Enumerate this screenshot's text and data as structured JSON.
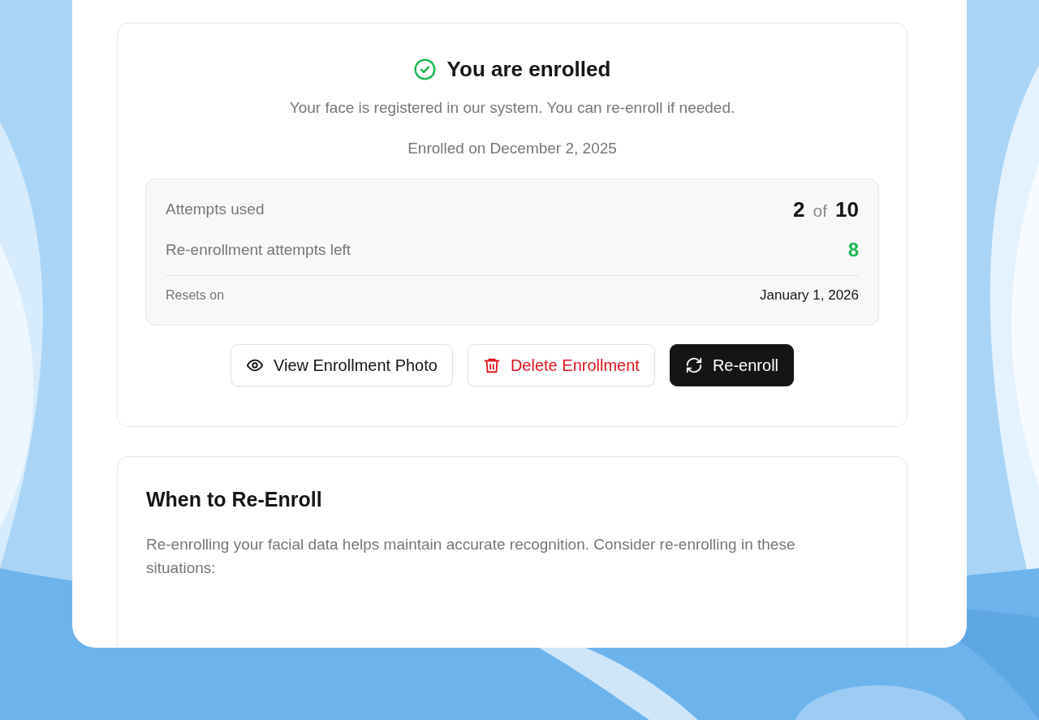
{
  "status_card": {
    "title": "You are enrolled",
    "enrolled": true,
    "description": "Your face is registered in our system. You can re-enroll if needed.",
    "enrolled_date": "Enrolled on December 2, 2025",
    "stats": [
      {
        "kind": "count",
        "label": "Attempts used",
        "value": "2",
        "separator": "of",
        "total": "10"
      },
      {
        "kind": "remaining",
        "label": "Re-enrollment attempts left",
        "value": "8"
      },
      {
        "kind": "date",
        "label": "Resets on",
        "value": "January 1, 2026"
      }
    ],
    "buttons": [
      {
        "kind": "outline",
        "label": "View Enrollment Photo"
      },
      {
        "kind": "danger",
        "label": "Delete Enrollment"
      },
      {
        "kind": "primary",
        "label": "Re-enroll"
      }
    ]
  },
  "info_card": {
    "title": "When to Re-Enroll",
    "text": "Re-enrolling your facial data helps maintain accurate recognition. Consider re-enrolling in these situations:"
  }
}
